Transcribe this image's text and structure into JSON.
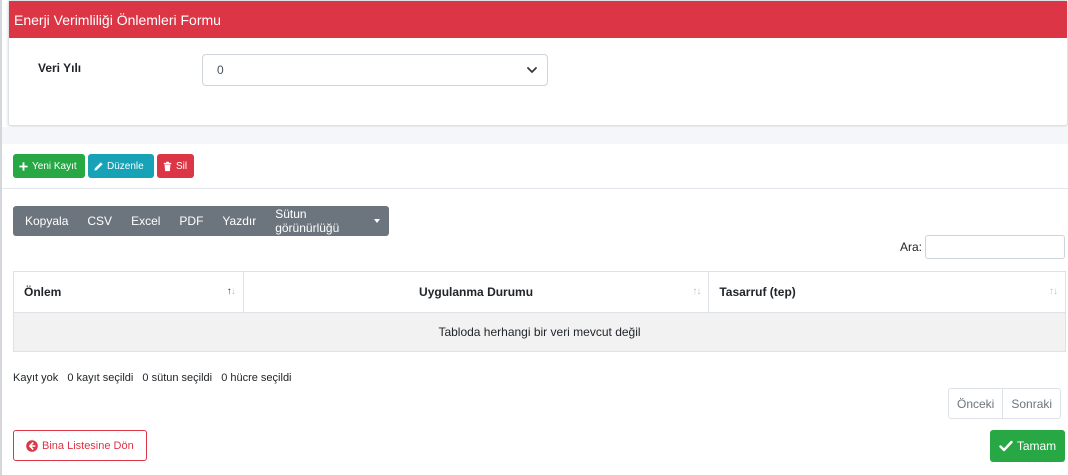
{
  "form": {
    "title": "Enerji Verimliliği Önlemleri Formu",
    "field_label": "Veri Yılı",
    "field_value": "0"
  },
  "actions": {
    "new_label": "Yeni Kayıt",
    "edit_label": "Düzenle",
    "delete_label": "Sil"
  },
  "toolbar": {
    "items": [
      "Kopyala",
      "CSV",
      "Excel",
      "PDF",
      "Yazdır",
      "Sütun görünürlüğü"
    ]
  },
  "search": {
    "label": "Ara:",
    "value": ""
  },
  "table": {
    "columns": [
      "Önlem",
      "Uygulanma Durumu",
      "Tasarruf (tep)"
    ],
    "empty_text": "Tabloda herhangi bir veri mevcut değil"
  },
  "info": {
    "records": "Kayıt yok",
    "rows_selected": "0 kayıt seçildi",
    "cols_selected": "0 sütun seçildi",
    "cells_selected": "0 hücre seçildi"
  },
  "pagination": {
    "prev": "Önceki",
    "next": "Sonraki"
  },
  "footer": {
    "back_label": "Bina Listesine Dön",
    "ok_label": "Tamam"
  },
  "colors": {
    "header_red": "#dc3545",
    "success_green": "#28a745",
    "info_teal": "#17a2b8",
    "toolbar_gray": "#6c757d"
  }
}
